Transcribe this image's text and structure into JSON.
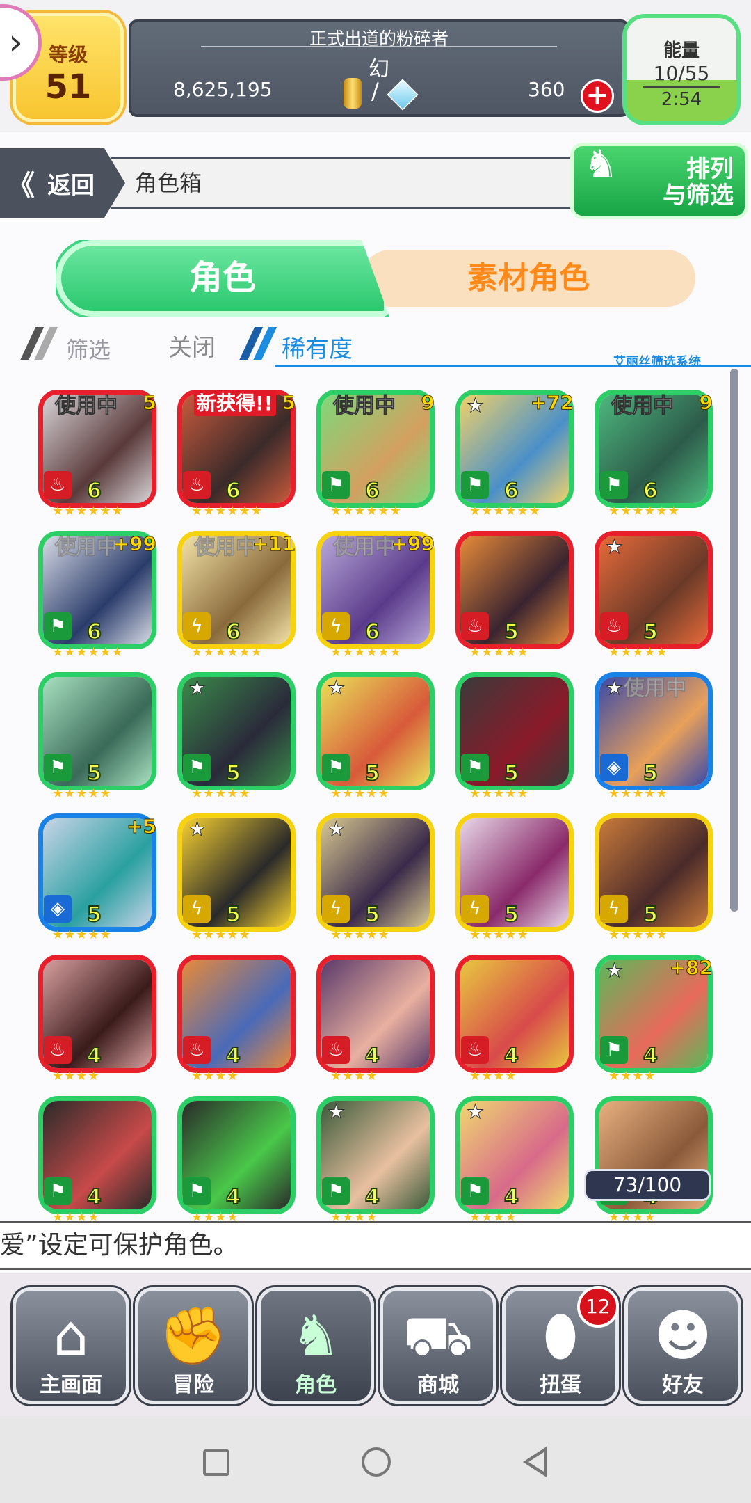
{
  "status": {
    "level_label": "等级",
    "level_value": "51",
    "title": "正式出道的粉碎者",
    "player_name": "幻",
    "coins": "8,625,195",
    "slash": "/",
    "gems": "360",
    "energy_label": "能量",
    "energy_value": "10/55",
    "energy_timer": "2:54"
  },
  "nav": {
    "back_arrows": "《",
    "back_label": "返回",
    "breadcrumb": "角色箱",
    "sort_line1": "排列",
    "sort_line2": "与筛选"
  },
  "tabs": {
    "characters": "角色",
    "materials": "素材角色"
  },
  "filter": {
    "label": "筛选",
    "close": "关闭",
    "rarity": "稀有度",
    "system_tag": "艾丽丝筛选系统"
  },
  "cards": [
    {
      "color": "red",
      "element": "fire",
      "level": "6",
      "stars": "★★★★★★",
      "badge": "使用中",
      "badge_style": "normal",
      "plus": "5",
      "fav": false,
      "art": [
        "#d8d4d8",
        "#5a3a3a"
      ]
    },
    {
      "color": "red",
      "element": "fire",
      "level": "6",
      "stars": "★★★★★★",
      "badge": "新获得!!",
      "badge_style": "new",
      "plus": "5",
      "fav": false,
      "art": [
        "#c85a3c",
        "#3a2a2a"
      ]
    },
    {
      "color": "green",
      "element": "wind",
      "level": "6",
      "stars": "★★★★★★",
      "badge": "使用中",
      "badge_style": "normal",
      "plus": "9",
      "fav": false,
      "art": [
        "#7ed87a",
        "#d3a060"
      ]
    },
    {
      "color": "green",
      "element": "wind",
      "level": "6",
      "stars": "★★★★★★",
      "badge": "",
      "badge_style": "normal",
      "plus": "+72",
      "fav": true,
      "art": [
        "#f1d26a",
        "#4a90c8"
      ]
    },
    {
      "color": "green",
      "element": "wind",
      "level": "6",
      "stars": "★★★★★★",
      "badge": "使用中",
      "badge_style": "normal",
      "plus": "9",
      "fav": false,
      "art": [
        "#4db87e",
        "#2d5a4a"
      ]
    },
    {
      "color": "green",
      "element": "wind",
      "level": "6",
      "stars": "★★★★★★",
      "badge": "使用中",
      "badge_style": "faded",
      "plus": "+99",
      "fav": false,
      "art": [
        "#d8dbe6",
        "#2a3c6a"
      ]
    },
    {
      "color": "yellow",
      "element": "thunder",
      "level": "6",
      "stars": "★★★★★★",
      "badge": "使用中",
      "badge_style": "faded",
      "plus": "+11",
      "fav": false,
      "art": [
        "#f1e2a6",
        "#8a6a3c"
      ]
    },
    {
      "color": "yellow",
      "element": "thunder",
      "level": "6",
      "stars": "★★★★★★",
      "badge": "使用中",
      "badge_style": "faded",
      "plus": "+99",
      "fav": false,
      "art": [
        "#b8a8d8",
        "#5a3a8a"
      ]
    },
    {
      "color": "red",
      "element": "fire",
      "level": "5",
      "stars": "★★★★★",
      "badge": "",
      "badge_style": "normal",
      "plus": "",
      "fav": false,
      "art": [
        "#e88a3a",
        "#3a2430"
      ]
    },
    {
      "color": "red",
      "element": "fire",
      "level": "5",
      "stars": "★★★★★",
      "badge": "",
      "badge_style": "normal",
      "plus": "",
      "fav": true,
      "art": [
        "#e86a3a",
        "#6a3a28"
      ]
    },
    {
      "color": "green",
      "element": "wind",
      "level": "5",
      "stars": "★★★★★",
      "badge": "",
      "badge_style": "normal",
      "plus": "",
      "fav": false,
      "art": [
        "#a8e0c0",
        "#3a6a58"
      ]
    },
    {
      "color": "green",
      "element": "wind",
      "level": "5",
      "stars": "★★★★★",
      "badge": "",
      "badge_style": "normal",
      "plus": "",
      "fav": true,
      "art": [
        "#3a8a4a",
        "#2a2a3a"
      ]
    },
    {
      "color": "green",
      "element": "wind",
      "level": "5",
      "stars": "★★★★★",
      "badge": "",
      "badge_style": "normal",
      "plus": "",
      "fav": true,
      "art": [
        "#e8e05a",
        "#d85a3a"
      ]
    },
    {
      "color": "green",
      "element": "wind",
      "level": "5",
      "stars": "★★★★★",
      "badge": "",
      "badge_style": "normal",
      "plus": "",
      "fav": false,
      "art": [
        "#3a3a3a",
        "#8a1a2a"
      ]
    },
    {
      "color": "blue",
      "element": "water",
      "level": "5",
      "stars": "★★★★★",
      "badge": "使用中",
      "badge_style": "faded",
      "plus": "",
      "fav": true,
      "art": [
        "#3a4aa8",
        "#e8a05a"
      ]
    },
    {
      "color": "blue",
      "element": "water",
      "level": "5",
      "stars": "★★★★★",
      "badge": "",
      "badge_style": "normal",
      "plus": "+5",
      "fav": false,
      "art": [
        "#c8d4e8",
        "#2aa0a0"
      ]
    },
    {
      "color": "yellow",
      "element": "thunder",
      "level": "5",
      "stars": "★★★★★",
      "badge": "",
      "badge_style": "normal",
      "plus": "",
      "fav": true,
      "art": [
        "#f6d030",
        "#2a2a2a"
      ]
    },
    {
      "color": "yellow",
      "element": "thunder",
      "level": "5",
      "stars": "★★★★★",
      "badge": "",
      "badge_style": "normal",
      "plus": "",
      "fav": true,
      "art": [
        "#d8c890",
        "#3a2a4a"
      ]
    },
    {
      "color": "yellow",
      "element": "thunder",
      "level": "5",
      "stars": "★★★★★",
      "badge": "",
      "badge_style": "normal",
      "plus": "",
      "fav": false,
      "art": [
        "#e8d8e8",
        "#8a2a6a"
      ]
    },
    {
      "color": "yellow",
      "element": "thunder",
      "level": "5",
      "stars": "★★★★★",
      "badge": "",
      "badge_style": "normal",
      "plus": "",
      "fav": false,
      "art": [
        "#c87a3a",
        "#4a2a2a"
      ]
    },
    {
      "color": "red",
      "element": "fire",
      "level": "4",
      "stars": "★★★★",
      "badge": "",
      "badge_style": "normal",
      "plus": "",
      "fav": false,
      "art": [
        "#d8a0a0",
        "#3a1a1a"
      ]
    },
    {
      "color": "red",
      "element": "fire",
      "level": "4",
      "stars": "★★★★",
      "badge": "",
      "badge_style": "normal",
      "plus": "",
      "fav": false,
      "art": [
        "#e88a3a",
        "#4a6ab8"
      ]
    },
    {
      "color": "red",
      "element": "fire",
      "level": "4",
      "stars": "★★★★",
      "badge": "",
      "badge_style": "normal",
      "plus": "",
      "fav": false,
      "art": [
        "#5a3a6a",
        "#e8b0a0"
      ]
    },
    {
      "color": "red",
      "element": "fire",
      "level": "4",
      "stars": "★★★★",
      "badge": "",
      "badge_style": "normal",
      "plus": "",
      "fav": false,
      "art": [
        "#e8c840",
        "#d84a4a"
      ]
    },
    {
      "color": "green",
      "element": "wind",
      "level": "4",
      "stars": "★★★★",
      "badge": "",
      "badge_style": "normal",
      "plus": "+82",
      "fav": true,
      "art": [
        "#5ab85a",
        "#e86a5a"
      ]
    },
    {
      "color": "green",
      "element": "wind",
      "level": "4",
      "stars": "★★★★",
      "badge": "",
      "badge_style": "normal",
      "plus": "",
      "fav": false,
      "art": [
        "#2a2a2a",
        "#c84a4a"
      ]
    },
    {
      "color": "green",
      "element": "wind",
      "level": "4",
      "stars": "★★★★",
      "badge": "",
      "badge_style": "normal",
      "plus": "",
      "fav": false,
      "art": [
        "#2a2a2a",
        "#4ac84a"
      ]
    },
    {
      "color": "green",
      "element": "wind",
      "level": "4",
      "stars": "★★★★",
      "badge": "",
      "badge_style": "normal",
      "plus": "",
      "fav": true,
      "art": [
        "#3a5a3a",
        "#e8c0a0"
      ]
    },
    {
      "color": "green",
      "element": "wind",
      "level": "4",
      "stars": "★★★★",
      "badge": "",
      "badge_style": "normal",
      "plus": "",
      "fav": true,
      "art": [
        "#f0d870",
        "#d86a8a"
      ]
    },
    {
      "color": "green",
      "element": "wind",
      "level": "4",
      "stars": "★★★★",
      "badge": "",
      "badge_style": "normal",
      "plus": "",
      "fav": false,
      "art": [
        "#e8b080",
        "#8a5a3a"
      ]
    }
  ],
  "counter": "73/100",
  "ticker": "爱”设定可保护角色。",
  "bottom_nav": [
    {
      "label": "主画面",
      "icon": "home-icon",
      "glyph": "⌂",
      "active": false
    },
    {
      "label": "冒险",
      "icon": "handshake-icon",
      "glyph": "✊",
      "active": false
    },
    {
      "label": "角色",
      "icon": "rabbit-icon",
      "glyph": "♞",
      "active": true
    },
    {
      "label": "商城",
      "icon": "cart-icon",
      "glyph": "⛟",
      "active": false
    },
    {
      "label": "扭蛋",
      "icon": "egg-icon",
      "glyph": "⬮",
      "active": false
    },
    {
      "label": "好友",
      "icon": "friends-icon",
      "glyph": "☻",
      "active": false
    }
  ],
  "gacha_badge": "12",
  "colors": {
    "red": "#e8202c",
    "green": "#2ccf65",
    "yellow": "#f6d20f",
    "blue": "#1a82e6",
    "fire": "#d61c24",
    "wind": "#1a9a3a",
    "thunder": "#d6a800",
    "water": "#1a6ad6"
  }
}
